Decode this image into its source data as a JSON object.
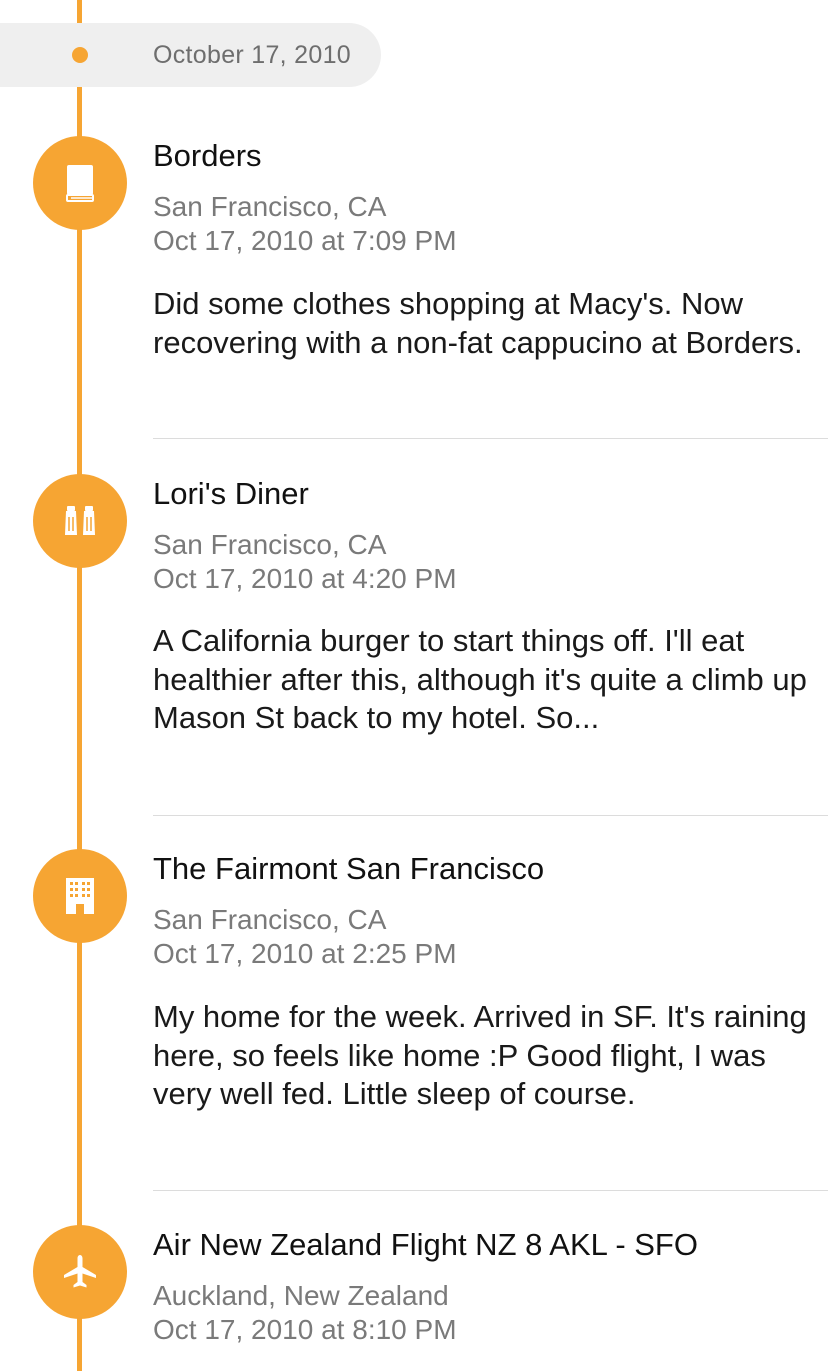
{
  "accent_color": "#f6a533",
  "date_header": {
    "label": "October 17, 2010"
  },
  "entries": [
    {
      "icon": "book-icon",
      "title": "Borders",
      "location": "San Francisco, CA",
      "time": "Oct 17, 2010 at 7:09 PM",
      "body": "Did some clothes shopping at Macy's. Now recovering with a non-fat cappucino at Borders."
    },
    {
      "icon": "salt-pepper-icon",
      "title": "Lori's Diner",
      "location": "San Francisco, CA",
      "time": "Oct 17, 2010 at 4:20 PM",
      "body": "A California burger to start things off. I'll eat healthier after this, although it's quite a climb up Mason St back to my hotel. So..."
    },
    {
      "icon": "hotel-icon",
      "title": "The Fairmont San Francisco",
      "location": "San Francisco, CA",
      "time": "Oct 17, 2010 at 2:25 PM",
      "body": "My home for the week. Arrived in SF. It's raining here, so feels like home :P Good flight, I was very well fed. Little sleep of course."
    },
    {
      "icon": "airplane-icon",
      "title": "Air New Zealand Flight NZ 8 AKL - SFO",
      "location": "Auckland, New Zealand",
      "time": "Oct 17, 2010 at 8:10 PM",
      "body": ""
    }
  ]
}
